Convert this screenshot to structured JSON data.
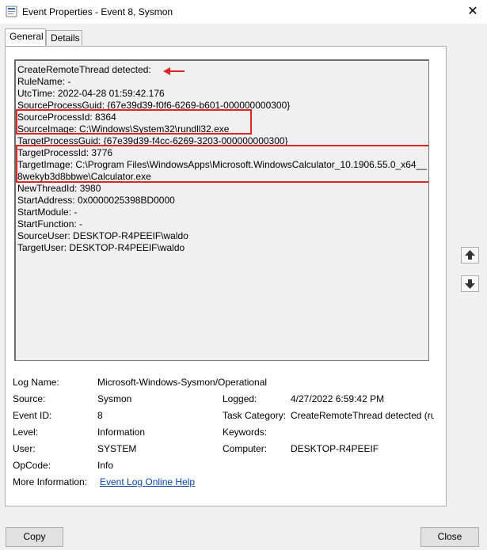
{
  "window": {
    "title": "Event Properties - Event 8, Sysmon",
    "close_glyph": "✕"
  },
  "tabs": [
    {
      "label": "General"
    },
    {
      "label": "Details"
    }
  ],
  "description_lines": [
    "CreateRemoteThread detected:",
    "RuleName: -",
    "UtcTime: 2022-04-28 01:59:42.176",
    "SourceProcessGuid: {67e39d39-f0f6-6269-b601-000000000300}",
    "SourceProcessId: 8364",
    "SourceImage: C:\\Windows\\System32\\rundll32.exe",
    "TargetProcessGuid: {67e39d39-f4cc-6269-3203-000000000300}",
    "TargetProcessId: 3776",
    "TargetImage: C:\\Program Files\\WindowsApps\\Microsoft.WindowsCalculator_10.1906.55.0_x64__",
    "8wekyb3d8bbwe\\Calculator.exe",
    "NewThreadId: 3980",
    "StartAddress: 0x0000025398BD0000",
    "StartModule: -",
    "StartFunction: -",
    "SourceUser: DESKTOP-R4PEEIF\\waldo",
    "TargetUser: DESKTOP-R4PEEIF\\waldo"
  ],
  "fields": {
    "log_name": {
      "label": "Log Name:",
      "value": "Microsoft-Windows-Sysmon/Operational"
    },
    "source": {
      "label": "Source:",
      "value": "Sysmon"
    },
    "logged": {
      "label": "Logged:",
      "value": "4/27/2022 6:59:42 PM"
    },
    "event_id": {
      "label": "Event ID:",
      "value": "8"
    },
    "task_category": {
      "label": "Task Category:",
      "value": "CreateRemoteThread detected (rul"
    },
    "level": {
      "label": "Level:",
      "value": "Information"
    },
    "keywords": {
      "label": "Keywords:",
      "value": ""
    },
    "user": {
      "label": "User:",
      "value": "SYSTEM"
    },
    "computer": {
      "label": "Computer:",
      "value": "DESKTOP-R4PEEIF"
    },
    "opcode": {
      "label": "OpCode:",
      "value": "Info"
    },
    "more_info": {
      "label": "More Information:",
      "link": "Event Log Online Help"
    }
  },
  "buttons": {
    "copy": "Copy",
    "close": "Close"
  },
  "icons": {
    "title": "event-viewer-icon",
    "scroll_up": "arrow-up-icon",
    "scroll_down": "arrow-down-icon"
  },
  "colors": {
    "highlight": "#e02525",
    "link": "#0645ad"
  }
}
